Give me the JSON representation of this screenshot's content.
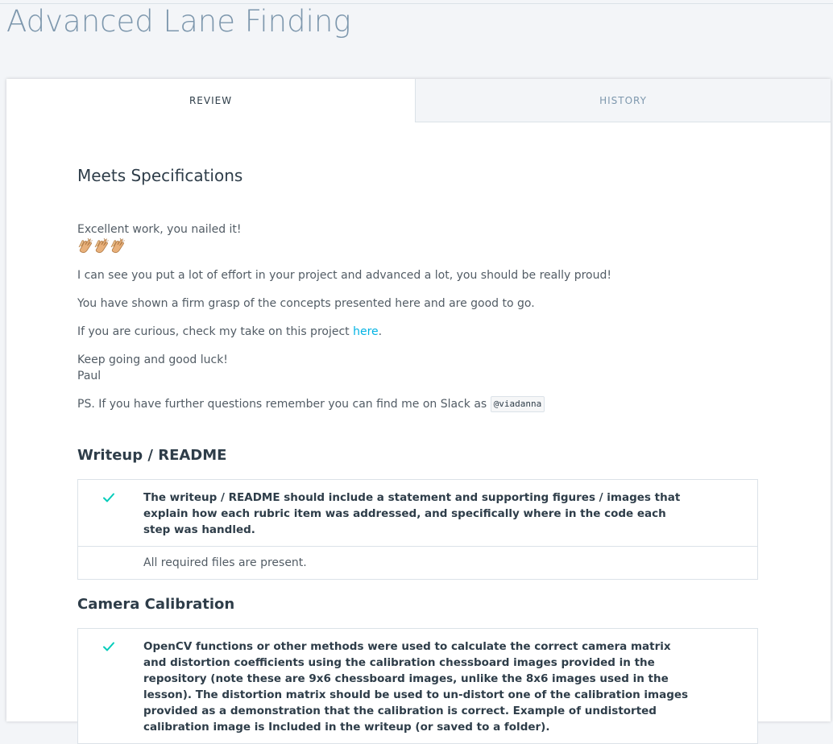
{
  "page": {
    "title": "Advanced Lane Finding"
  },
  "tabs": [
    {
      "label": "REVIEW",
      "active": true
    },
    {
      "label": "HISTORY",
      "active": false
    }
  ],
  "review": {
    "status": "Meets Specifications",
    "greeting": "Excellent work, you nailed it!",
    "clap_icons": [
      "clapping-hands-icon",
      "clapping-hands-icon",
      "clapping-hands-icon"
    ],
    "p1": "I can see you put a lot of effort in your project and advanced a lot, you should be really proud!",
    "p2": "You have shown a firm grasp of the concepts presented here and are good to go.",
    "p3_before": "If you are curious, check my take on this project ",
    "p3_link": "here",
    "p3_after": ".",
    "p4_line1": "Keep going and good luck!",
    "p4_line2": "Paul",
    "p5_before": "PS. If you have further questions remember you can find me on Slack as ",
    "p5_code": "@viadanna"
  },
  "sections": [
    {
      "title": "Writeup / README",
      "rubrics": [
        {
          "status_icon": "check-icon",
          "criteria": "The writeup / README should include a statement and supporting figures / images that explain how each rubric item was addressed, and specifically where in the code each step was handled.",
          "comment": "All required files are present."
        }
      ]
    },
    {
      "title": "Camera Calibration",
      "rubrics": [
        {
          "status_icon": "check-icon",
          "criteria": "OpenCV functions or other methods were used to calculate the correct camera matrix and distortion coefficients using the calibration chessboard images provided in the repository (note these are 9x6 chessboard images, unlike the 8x6 images used in the lesson). The distortion matrix should be used to un-distort one of the calibration images provided as a demonstration that the calibration is correct. Example of undistorted calibration image is Included in the writeup (or saved to a folder)."
        }
      ]
    }
  ],
  "colors": {
    "accent_link": "#02b3e4",
    "check_green": "#02ccba",
    "title_gray": "#7d97ad"
  }
}
